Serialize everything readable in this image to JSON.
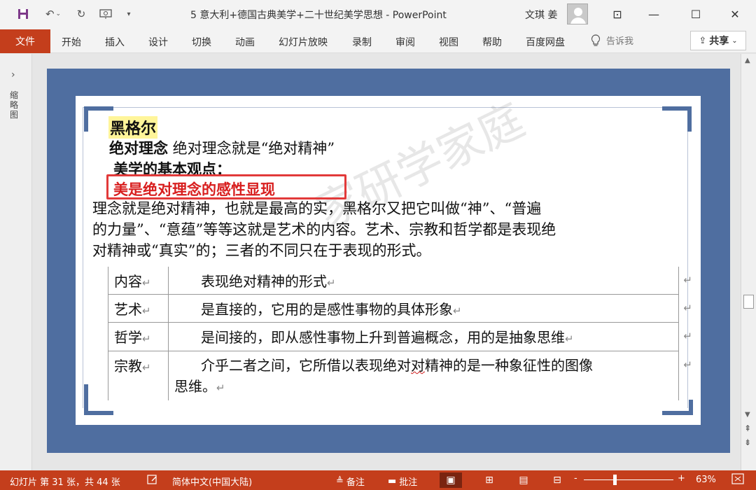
{
  "window": {
    "title": "5 意大利+德国古典美学+二十世纪美学思想  -  PowerPoint",
    "user": "文琪 姜",
    "qa_icons": [
      "save-icon",
      "undo-icon",
      "redo-icon",
      "present-icon",
      "customize-icon"
    ],
    "minimize": "—",
    "maximize": "☐",
    "close": "✕",
    "ribbon_display": "⊡"
  },
  "ribbon": {
    "file": "文件",
    "tabs": [
      "开始",
      "插入",
      "设计",
      "切换",
      "动画",
      "幻灯片放映",
      "录制",
      "审阅",
      "视图",
      "帮助",
      "百度网盘"
    ],
    "tell_me": "告诉我",
    "share": "共享"
  },
  "thumbnail_pane": {
    "label": "缩略图"
  },
  "slide": {
    "heading": "黑格尔",
    "line2_bold": "绝对理念",
    "line2_rest": "  绝对理念就是“绝对精神”",
    "line3": "美学的基本观点：",
    "highlight": "美是绝对理念的感性显现",
    "paragraph_lines": [
      "    理念就是绝对精神，也就是最高的实，黑格尔又把它叫做“神”、“普遍",
      "的力量”、“意蕴”等等这就是艺术的内容。艺术、宗教和哲学都是表现绝",
      "对精神或“真实”的；三者的不同只在于表现的形式。"
    ],
    "table": [
      {
        "left": "内容",
        "right": "表现绝对精神的形式"
      },
      {
        "left": "艺术",
        "right": "是直接的，它用的是感性事物的具体形象"
      },
      {
        "left": "哲学",
        "right": "是间接的，即从感性事物上升到普遍概念，用的是抽象思维"
      },
      {
        "left": "宗教",
        "right_a": "介乎二者之间，它所借以表现绝对",
        "right_b": "对",
        "right_c": "精神的是一种象征性的图像",
        "right_line2": "思维。"
      }
    ],
    "para_mark": "↵",
    "watermark": "家研学家庭"
  },
  "statusbar": {
    "slide_info": "幻灯片 第 31 张，共 44 张",
    "language": "简体中文(中国大陆)",
    "notes": "备注",
    "comments": "批注",
    "zoom_minus": "-",
    "zoom_plus": "+",
    "zoom": "63%",
    "zoom_fraction": 0.33
  },
  "colors": {
    "accent": "#c43e1c",
    "slide_blue": "#4f6ea0",
    "highlight_red": "#d81e1e",
    "heading_highlight": "#fff59a"
  }
}
